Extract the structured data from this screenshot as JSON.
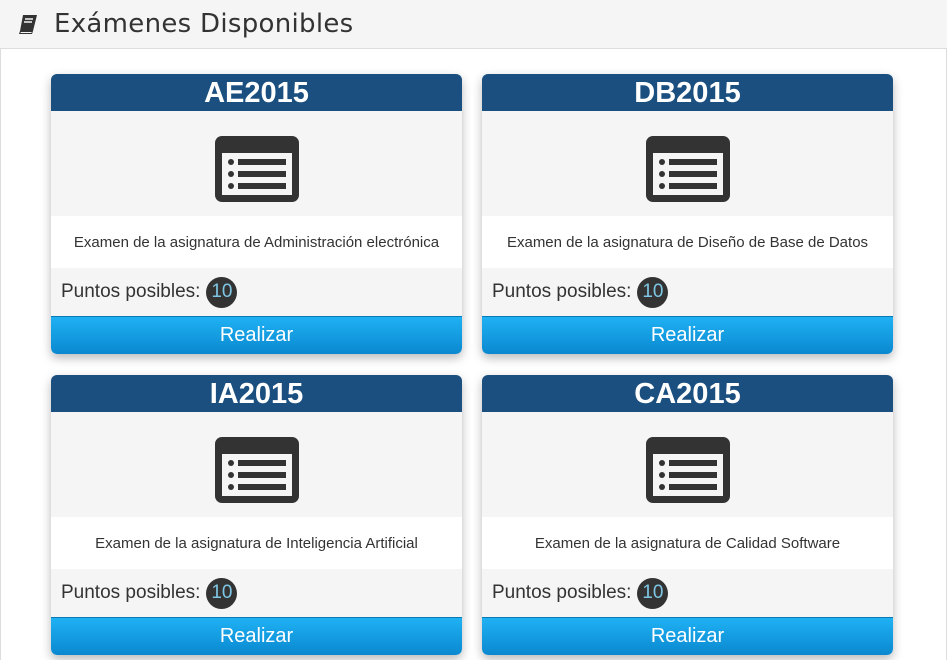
{
  "header": {
    "title": "Exámenes Disponibles",
    "icon": "book-icon"
  },
  "exams": [
    {
      "code": "AE2015",
      "icon": "list-icon",
      "description": "Examen de la asignatura de Administración electrónica",
      "points_label": "Puntos posibles:",
      "points": "10",
      "action_label": "Realizar"
    },
    {
      "code": "DB2015",
      "icon": "list-icon",
      "description": "Examen de la asignatura de Diseño de Base de Datos",
      "points_label": "Puntos posibles:",
      "points": "10",
      "action_label": "Realizar"
    },
    {
      "code": "IA2015",
      "icon": "list-icon",
      "description": "Examen de la asignatura de Inteligencia Artificial",
      "points_label": "Puntos posibles:",
      "points": "10",
      "action_label": "Realizar"
    },
    {
      "code": "CA2015",
      "icon": "list-icon",
      "description": "Examen de la asignatura de Calidad Software",
      "points_label": "Puntos posibles:",
      "points": "10",
      "action_label": "Realizar"
    }
  ],
  "colors": {
    "card_header": "#1b4f80",
    "button_top": "#1fb1f3",
    "button_bottom": "#0a88d0",
    "badge_bg": "#333333",
    "badge_text": "#7fc6e4"
  }
}
